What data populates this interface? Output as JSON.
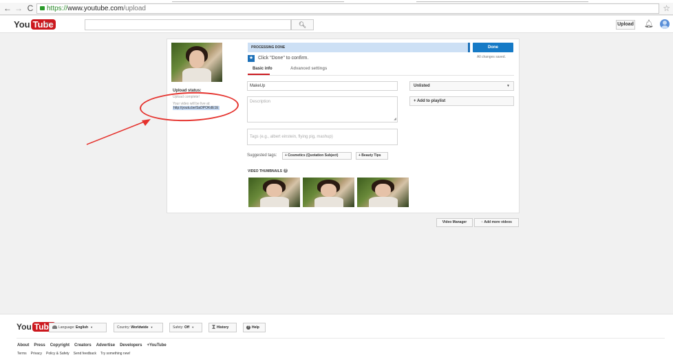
{
  "browser": {
    "url_scheme": "https://",
    "url_host": "www.youtube.com",
    "url_path": "/upload"
  },
  "header": {
    "logo_you": "You",
    "logo_tube": "Tube",
    "guide_label": "≡ -",
    "search_placeholder": "",
    "upload_label": "Upload"
  },
  "upload": {
    "status_label": "Upload status:",
    "status_sub": "Upload complete!",
    "live_at_text": "Your video will be live at:",
    "video_url": "http://youtu.be/SaDPOKdE1E",
    "processing_text": "PROCESSING DONE",
    "done_label": "Done",
    "saved_text": "All changes saved.",
    "confirm_text": "Click \"Done\" to confirm.",
    "tabs": [
      {
        "label": "Basic info",
        "active": true
      },
      {
        "label": "Advanced settings",
        "active": false
      }
    ],
    "title_value": "MakeUp",
    "description_placeholder": "Description",
    "tags_placeholder": "Tags (e.g., albert einstein, flying pig, mashup)",
    "privacy_value": "Unlisted",
    "add_playlist_label": "+ Add to playlist",
    "suggested_label": "Suggested tags:",
    "suggested_tags": [
      "+ Cosmetics (Quotation Subject)",
      "+ Beauty Tips"
    ],
    "thumbnails_label": "VIDEO THUMBNAILS",
    "video_manager_label": "Video Manager",
    "add_more_label": "Add more videos"
  },
  "footer": {
    "language_label": "Language:",
    "language_value": "English",
    "country_label": "Country:",
    "country_value": "Worldwide",
    "safety_label": "Safety:",
    "safety_value": "Off",
    "history_label": "History",
    "help_label": "Help",
    "links": [
      "About",
      "Press",
      "Copyright",
      "Creators",
      "Advertise",
      "Developers",
      "+YouTube"
    ],
    "sublinks": [
      "Terms",
      "Privacy",
      "Policy & Safety",
      "Send feedback",
      "Try something new!"
    ]
  },
  "colors": {
    "brand_red": "#cc181e",
    "primary_blue": "#167ac6",
    "annotation_red": "#e5322d"
  }
}
